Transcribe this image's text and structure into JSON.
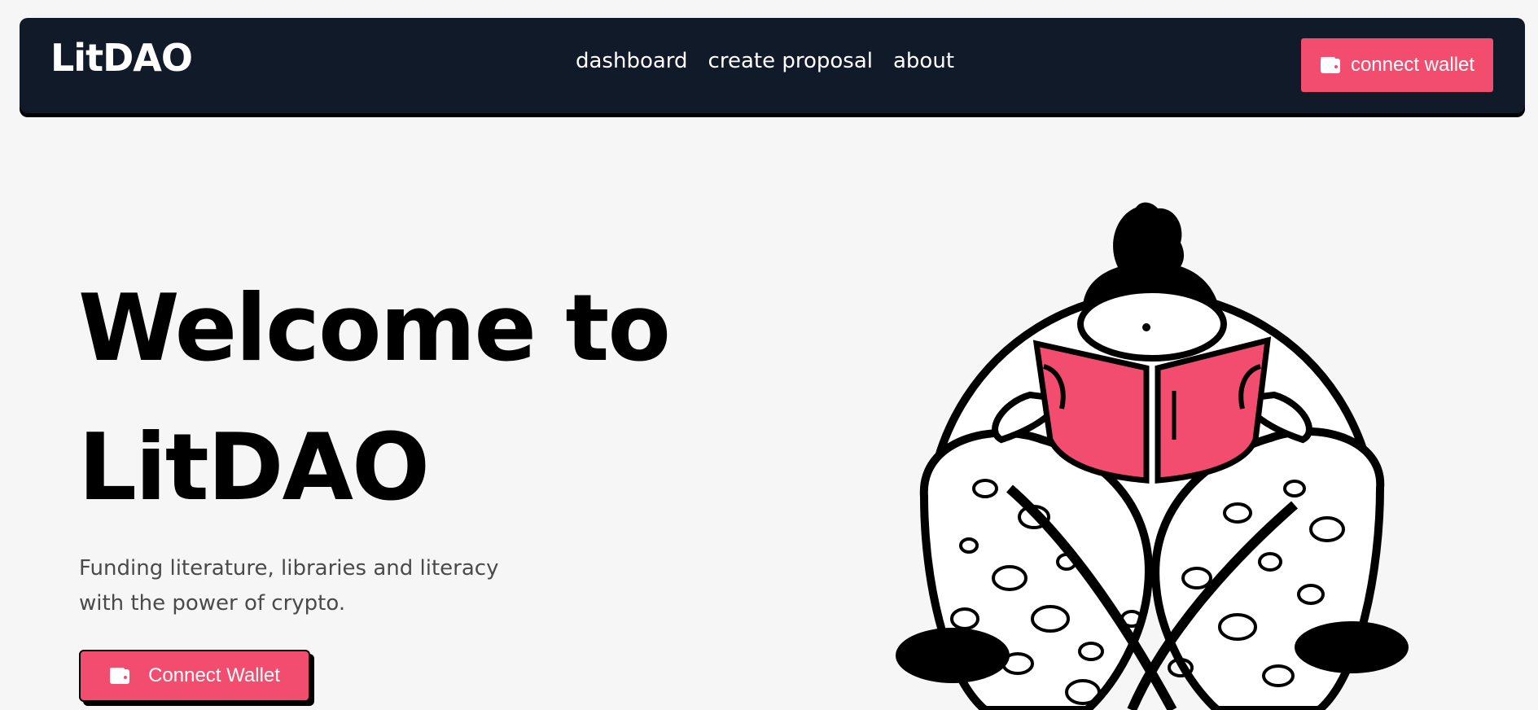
{
  "header": {
    "brand": "LitDAO",
    "nav": [
      {
        "label": "dashboard"
      },
      {
        "label": "create proposal"
      },
      {
        "label": "about"
      }
    ],
    "connect_button": {
      "label": "connect wallet",
      "icon": "wallet-icon"
    }
  },
  "hero": {
    "title": "Welcome to LitDAO",
    "subtitle": "Funding literature, libraries and literacy with the power of crypto.",
    "cta_button": {
      "label": "Connect Wallet",
      "icon": "wallet-icon"
    },
    "illustration": "person-reading-book-illustration"
  },
  "colors": {
    "navbar": "#111a29",
    "accent": "#f24d6f",
    "background": "#f5f6f5",
    "text": "#000000"
  }
}
